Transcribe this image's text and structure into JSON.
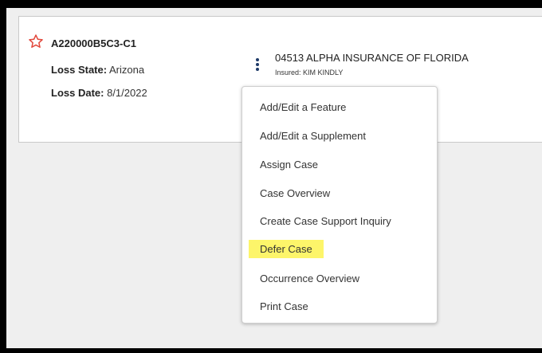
{
  "card": {
    "case_id": "A220000B5C3-C1",
    "loss_state_label": "Loss State:",
    "loss_state_value": "Arizona",
    "loss_date_label": "Loss Date:",
    "loss_date_value": "8/1/2022",
    "policy": "04513 ALPHA INSURANCE OF FLORIDA",
    "insured": "Insured: KIM KINDLY",
    "star_color": "#e2483c"
  },
  "menu": {
    "items": [
      {
        "label": "Add/Edit a Feature"
      },
      {
        "label": "Add/Edit a Supplement"
      },
      {
        "label": "Assign Case"
      },
      {
        "label": "Case Overview"
      },
      {
        "label": "Create Case Support Inquiry"
      },
      {
        "label": "Defer Case",
        "highlighted": true
      },
      {
        "label": "Occurrence Overview"
      },
      {
        "label": "Print Case"
      }
    ],
    "highlight_color": "#fdf56a"
  }
}
